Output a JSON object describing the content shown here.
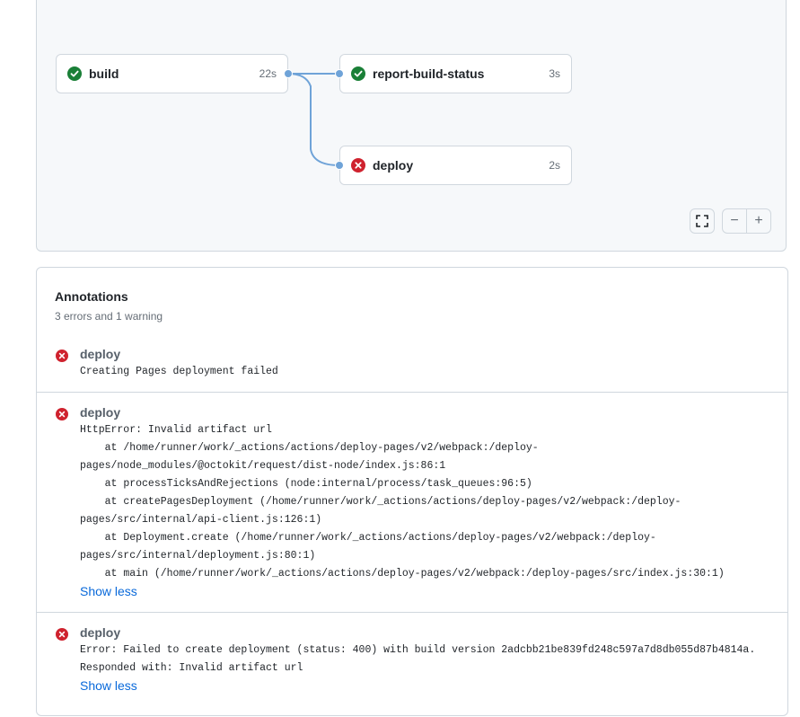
{
  "graph": {
    "jobs": [
      {
        "name": "build",
        "duration": "22s",
        "status": "success"
      },
      {
        "name": "report-build-status",
        "duration": "3s",
        "status": "success"
      },
      {
        "name": "deploy",
        "duration": "2s",
        "status": "failure"
      }
    ],
    "colors": {
      "success": "#1a7f37",
      "failure": "#cf222e",
      "connector": "#6fa3d8"
    }
  },
  "controls": {
    "fullscreen_icon": "fullscreen-icon",
    "zoom_out_label": "−",
    "zoom_in_label": "+"
  },
  "annotations": {
    "title": "Annotations",
    "summary": "3 errors and 1 warning",
    "items": [
      {
        "job": "deploy",
        "message": "Creating Pages deployment failed"
      },
      {
        "job": "deploy",
        "message": "HttpError: Invalid artifact url\n    at /home/runner/work/_actions/actions/deploy-pages/v2/webpack:/deploy-pages/node_modules/@octokit/request/dist-node/index.js:86:1\n    at processTicksAndRejections (node:internal/process/task_queues:96:5)\n    at createPagesDeployment (/home/runner/work/_actions/actions/deploy-pages/v2/webpack:/deploy-pages/src/internal/api-client.js:126:1)\n    at Deployment.create (/home/runner/work/_actions/actions/deploy-pages/v2/webpack:/deploy-pages/src/internal/deployment.js:80:1)\n    at main (/home/runner/work/_actions/actions/deploy-pages/v2/webpack:/deploy-pages/src/index.js:30:1)",
        "link": "Show less"
      },
      {
        "job": "deploy",
        "message": "Error: Failed to create deployment (status: 400) with build version 2adcbb21be839fd248c597a7d8db055d87b4814a.\nResponded with: Invalid artifact url",
        "link": "Show less"
      }
    ]
  }
}
